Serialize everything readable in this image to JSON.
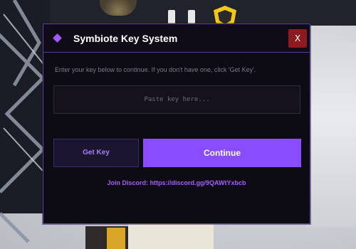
{
  "dialog": {
    "title": "Symbiote Key System",
    "close_label": "X",
    "instruction": "Enter your key below to continue. If you don't have one, click 'Get Key'.",
    "key_input": {
      "value": "",
      "placeholder": "Paste key here..."
    },
    "get_key_label": "Get Key",
    "continue_label": "Continue",
    "discord_text": "Join Discord: https://discord.gg/9QAWtYxbcb"
  },
  "colors": {
    "accent": "#8a4cff",
    "accent_text": "#a65bff",
    "close_button": "#8c1a1f",
    "dialog_background": "#0d0b14"
  },
  "icons": {
    "title_icon": "purple-diamond-icon"
  }
}
